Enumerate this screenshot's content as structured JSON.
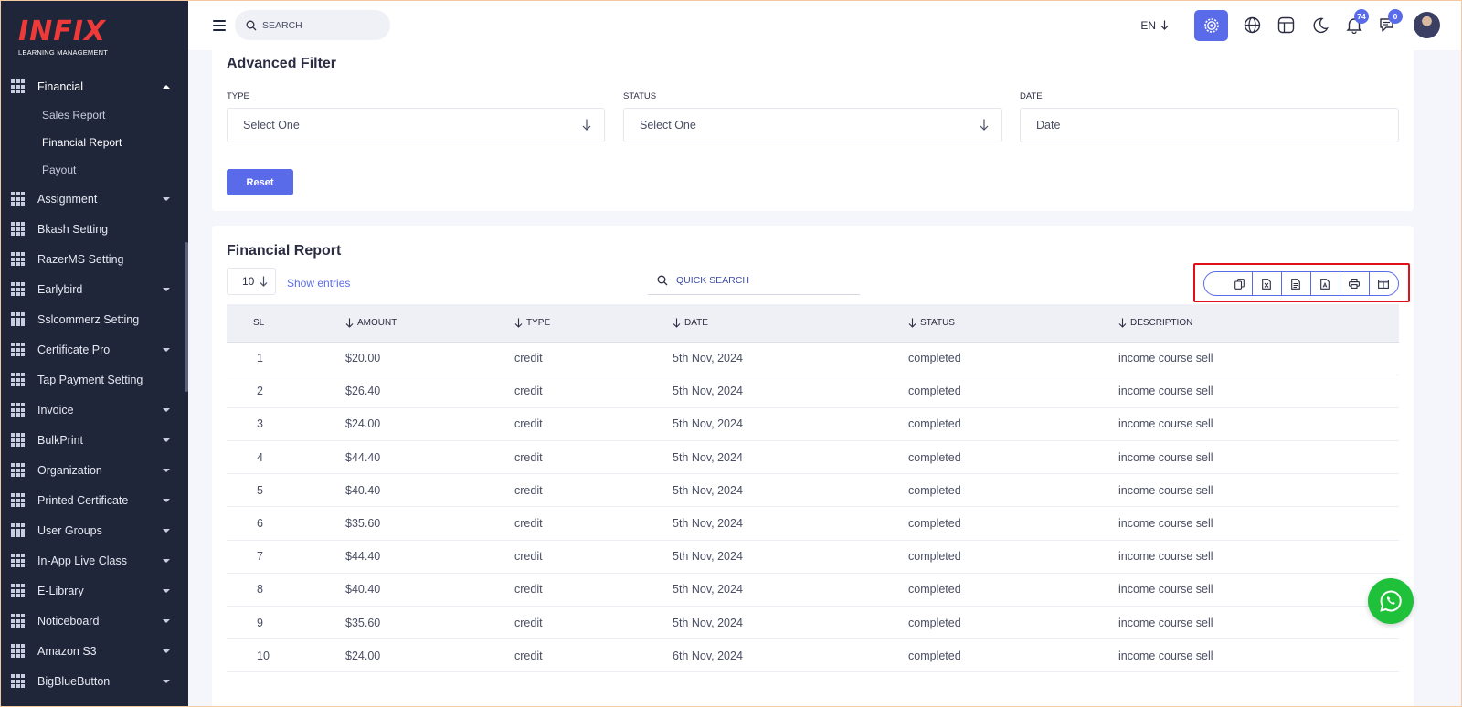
{
  "brand": {
    "name": "INFIX",
    "tagline": "LEARNING MANAGEMENT"
  },
  "sidebar": {
    "active_item": {
      "label": "Financial"
    },
    "sub_items": [
      {
        "label": "Sales Report"
      },
      {
        "label": "Financial Report"
      },
      {
        "label": "Payout"
      }
    ],
    "items": [
      {
        "label": "Assignment",
        "has_caret": true
      },
      {
        "label": "Bkash Setting",
        "has_caret": false
      },
      {
        "label": "RazerMS Setting",
        "has_caret": false
      },
      {
        "label": "Earlybird",
        "has_caret": true
      },
      {
        "label": "Sslcommerz Setting",
        "has_caret": false
      },
      {
        "label": "Certificate Pro",
        "has_caret": true
      },
      {
        "label": "Tap Payment Setting",
        "has_caret": false
      },
      {
        "label": "Invoice",
        "has_caret": true
      },
      {
        "label": "BulkPrint",
        "has_caret": true
      },
      {
        "label": "Organization",
        "has_caret": true
      },
      {
        "label": "Printed Certificate",
        "has_caret": true
      },
      {
        "label": "User Groups",
        "has_caret": true
      },
      {
        "label": "In-App Live Class",
        "has_caret": true
      },
      {
        "label": "E-Library",
        "has_caret": true
      },
      {
        "label": "Noticeboard",
        "has_caret": true
      },
      {
        "label": "Amazon S3",
        "has_caret": true
      },
      {
        "label": "BigBlueButton",
        "has_caret": true
      }
    ]
  },
  "header": {
    "search_placeholder": "SEARCH",
    "language": "EN",
    "notifications_count": "74",
    "messages_count": "0"
  },
  "filter": {
    "title": "Advanced Filter",
    "type_label": "TYPE",
    "type_value": "Select One",
    "status_label": "STATUS",
    "status_value": "Select One",
    "date_label": "DATE",
    "date_placeholder": "Date",
    "reset_label": "Reset"
  },
  "report": {
    "title": "Financial Report",
    "entries_value": "10",
    "entries_label": "Show entries",
    "quick_search_placeholder": "QUICK SEARCH",
    "export_buttons": [
      "copy-icon",
      "excel-icon",
      "csv-icon",
      "pdf-icon",
      "print-icon",
      "columns-icon"
    ],
    "columns": [
      "SL",
      "AMOUNT",
      "TYPE",
      "DATE",
      "STATUS",
      "DESCRIPTION"
    ],
    "rows": [
      [
        "1",
        "$20.00",
        "credit",
        "5th Nov, 2024",
        "completed",
        "income course sell"
      ],
      [
        "2",
        "$26.40",
        "credit",
        "5th Nov, 2024",
        "completed",
        "income course sell"
      ],
      [
        "3",
        "$24.00",
        "credit",
        "5th Nov, 2024",
        "completed",
        "income course sell"
      ],
      [
        "4",
        "$44.40",
        "credit",
        "5th Nov, 2024",
        "completed",
        "income course sell"
      ],
      [
        "5",
        "$40.40",
        "credit",
        "5th Nov, 2024",
        "completed",
        "income course sell"
      ],
      [
        "6",
        "$35.60",
        "credit",
        "5th Nov, 2024",
        "completed",
        "income course sell"
      ],
      [
        "7",
        "$44.40",
        "credit",
        "5th Nov, 2024",
        "completed",
        "income course sell"
      ],
      [
        "8",
        "$40.40",
        "credit",
        "5th Nov, 2024",
        "completed",
        "income course sell"
      ],
      [
        "9",
        "$35.60",
        "credit",
        "5th Nov, 2024",
        "completed",
        "income course sell"
      ],
      [
        "10",
        "$24.00",
        "credit",
        "6th Nov, 2024",
        "completed",
        "income course sell"
      ]
    ]
  },
  "colors": {
    "accent": "#5a6bea",
    "sidebar_bg": "#202639",
    "highlight": "#e0101b",
    "whatsapp": "#20c13a",
    "logo": "#ef3a3a"
  }
}
